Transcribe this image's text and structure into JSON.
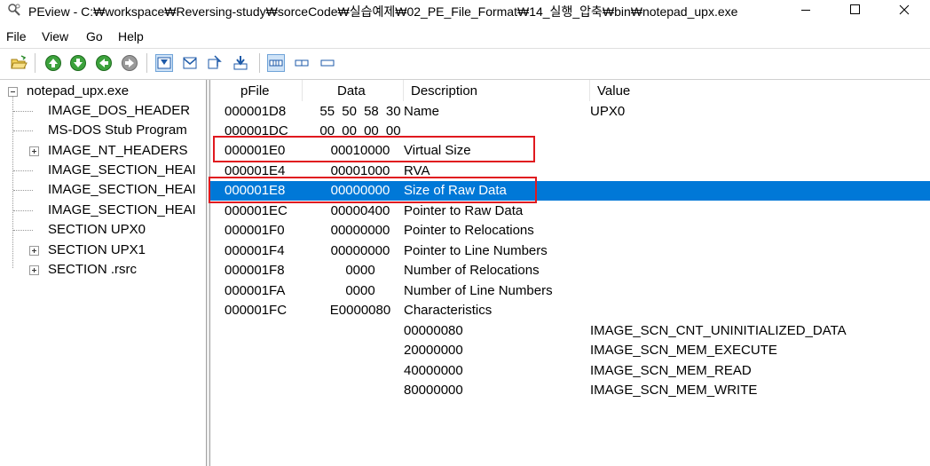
{
  "window": {
    "title": "PEview - C:₩workspace₩Reversing-study₩sorceCode₩실습예제₩02_PE_File_Format₩14_실행_압축₩bin₩notepad_upx.exe",
    "icon": "magnifier-icon"
  },
  "menu": [
    "File",
    "View",
    "Go",
    "Help"
  ],
  "toolbar": {
    "icons": [
      "open-folder-icon",
      "back-green-icon",
      "forward-green-icon",
      "up-green-icon",
      "down-gray-icon",
      "view-bytes-icon",
      "view-words-icon",
      "view-dwords-icon",
      "view-qwords-icon",
      "layout-1-icon",
      "layout-2-icon",
      "layout-3-icon"
    ]
  },
  "tree": {
    "root": "notepad_upx.exe",
    "items": [
      {
        "label": "IMAGE_DOS_HEADER",
        "expandable": false
      },
      {
        "label": "MS-DOS Stub Program",
        "expandable": false
      },
      {
        "label": "IMAGE_NT_HEADERS",
        "expandable": true
      },
      {
        "label": "IMAGE_SECTION_HEAI",
        "expandable": false
      },
      {
        "label": "IMAGE_SECTION_HEAI",
        "expandable": false
      },
      {
        "label": "IMAGE_SECTION_HEAI",
        "expandable": false
      },
      {
        "label": "SECTION UPX0",
        "expandable": false
      },
      {
        "label": "SECTION UPX1",
        "expandable": true
      },
      {
        "label": "SECTION .rsrc",
        "expandable": true
      }
    ]
  },
  "list": {
    "columns": [
      "pFile",
      "Data",
      "Description",
      "Value"
    ],
    "rows": [
      {
        "pfile": "000001D8",
        "data": "55 50 58 30",
        "desc": "Name",
        "value": "UPX0"
      },
      {
        "pfile": "000001DC",
        "data": "00 00 00 00",
        "desc": "",
        "value": ""
      },
      {
        "pfile": "000001E0",
        "data": "00010000",
        "desc": "Virtual Size",
        "value": ""
      },
      {
        "pfile": "000001E4",
        "data": "00001000",
        "desc": "RVA",
        "value": ""
      },
      {
        "pfile": "000001E8",
        "data": "00000000",
        "desc": "Size of Raw Data",
        "value": ""
      },
      {
        "pfile": "000001EC",
        "data": "00000400",
        "desc": "Pointer to Raw Data",
        "value": ""
      },
      {
        "pfile": "000001F0",
        "data": "00000000",
        "desc": "Pointer to Relocations",
        "value": ""
      },
      {
        "pfile": "000001F4",
        "data": "00000000",
        "desc": "Pointer to Line Numbers",
        "value": ""
      },
      {
        "pfile": "000001F8",
        "data": "0000",
        "desc": "Number of Relocations",
        "value": ""
      },
      {
        "pfile": "000001FA",
        "data": "0000",
        "desc": "Number of Line Numbers",
        "value": ""
      },
      {
        "pfile": "000001FC",
        "data": "E0000080",
        "desc": "Characteristics",
        "value": ""
      },
      {
        "pfile": "",
        "data": "",
        "desc": "00000080",
        "value": "IMAGE_SCN_CNT_UNINITIALIZED_DATA"
      },
      {
        "pfile": "",
        "data": "",
        "desc": "20000000",
        "value": "IMAGE_SCN_MEM_EXECUTE"
      },
      {
        "pfile": "",
        "data": "",
        "desc": "40000000",
        "value": "IMAGE_SCN_MEM_READ"
      },
      {
        "pfile": "",
        "data": "",
        "desc": "80000000",
        "value": "IMAGE_SCN_MEM_WRITE"
      }
    ]
  },
  "colors": {
    "selection": "#0078d7",
    "highlight_box": "#e0191f"
  }
}
